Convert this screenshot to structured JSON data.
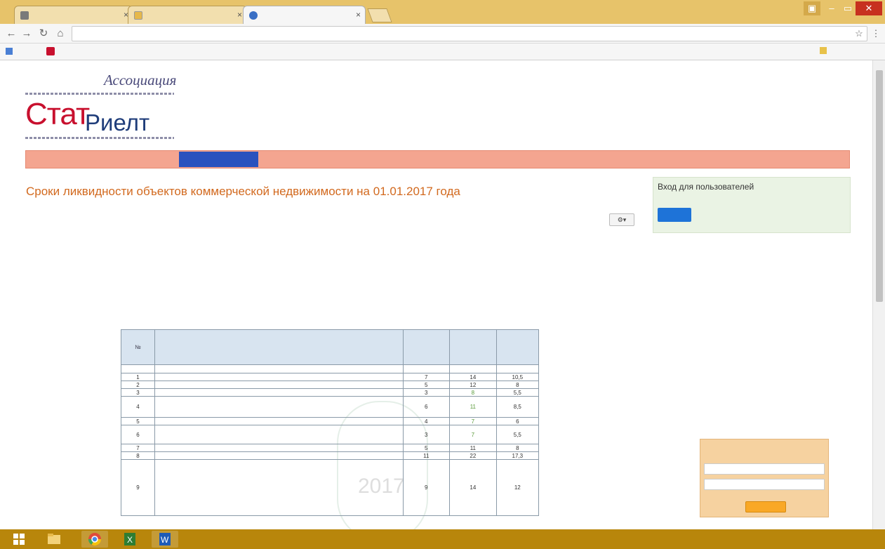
{
  "browser": {
    "tabs": [
      {
        "label": "",
        "active": false
      },
      {
        "label": "",
        "active": false
      },
      {
        "label": "",
        "active": true
      }
    ],
    "url": "",
    "bookmarks": [
      {
        "label": ""
      },
      {
        "label": ""
      }
    ],
    "other_bookmarks": ""
  },
  "logo": {
    "association": "Ассоциация",
    "brand_part1": "Стат",
    "brand_part2": "Риелт"
  },
  "menu": [
    {
      "label": ""
    },
    {
      "label": ""
    },
    {
      "label": "",
      "active": true
    },
    {
      "label": ""
    },
    {
      "label": ""
    },
    {
      "label": ""
    },
    {
      "label": ""
    },
    {
      "label": ""
    },
    {
      "label": ""
    },
    {
      "label": ""
    }
  ],
  "page": {
    "title": "Сроки ликвидности объектов коммерческой недвижимости на 01.01.2017 года",
    "details_label": "",
    "meta": [
      {
        "label": "",
        "link": ""
      },
      {
        "label": "",
        "link": ""
      }
    ],
    "tools_icon": "gear-icon",
    "intro": "",
    "bullets": [
      "",
      "",
      "",
      "",
      ""
    ],
    "table_caption": {
      "prefix": "",
      "link": "",
      "suffix": ""
    }
  },
  "table": {
    "headers": [
      "№",
      "",
      "",
      "",
      ""
    ],
    "section_title": "",
    "rows": [
      {
        "n": "1",
        "desc": "",
        "lower": "7",
        "upper": "14",
        "avg": "10,5"
      },
      {
        "n": "2",
        "desc": "",
        "lower": "5",
        "upper": "12",
        "avg": "8"
      },
      {
        "n": "3",
        "desc": "",
        "lower": "3",
        "upper": "8",
        "avg": "5,5"
      },
      {
        "n": "4",
        "desc": "",
        "lower": "6",
        "upper": "11",
        "avg": "8,5"
      },
      {
        "n": "5",
        "desc": "",
        "lower": "4",
        "upper": "7",
        "avg": "6"
      },
      {
        "n": "6",
        "desc": "",
        "lower": "3",
        "upper": "7",
        "avg": "5,5"
      },
      {
        "n": "7",
        "desc": "",
        "lower": "5",
        "upper": "11",
        "avg": "8"
      },
      {
        "n": "8",
        "desc": "",
        "lower": "11",
        "upper": "22",
        "avg": "17,3"
      },
      {
        "n": "9",
        "desc": "",
        "lower": "9",
        "upper": "14",
        "avg": "12"
      }
    ],
    "watermark": "2017"
  },
  "login": {
    "title": "Вход для пользователей",
    "user": "",
    "button": ""
  },
  "feedback": {
    "question": "",
    "yes": "",
    "no": "",
    "input1_placeholder": "",
    "input2_placeholder": "",
    "send": ""
  },
  "taskbar": {
    "apps": [
      "windows-start-icon",
      "file-explorer-icon",
      "chrome-icon",
      "excel-icon",
      "word-icon"
    ],
    "tray_text": ""
  },
  "colors": {
    "menu_bg": "#f4a590",
    "menu_active": "#2a52be",
    "title_orange": "#d2691e",
    "brand_red": "#c8102e",
    "brand_blue": "#1f3d7a",
    "login_bg": "#eaf3e4",
    "feedback_bg": "#f6d2a0"
  }
}
